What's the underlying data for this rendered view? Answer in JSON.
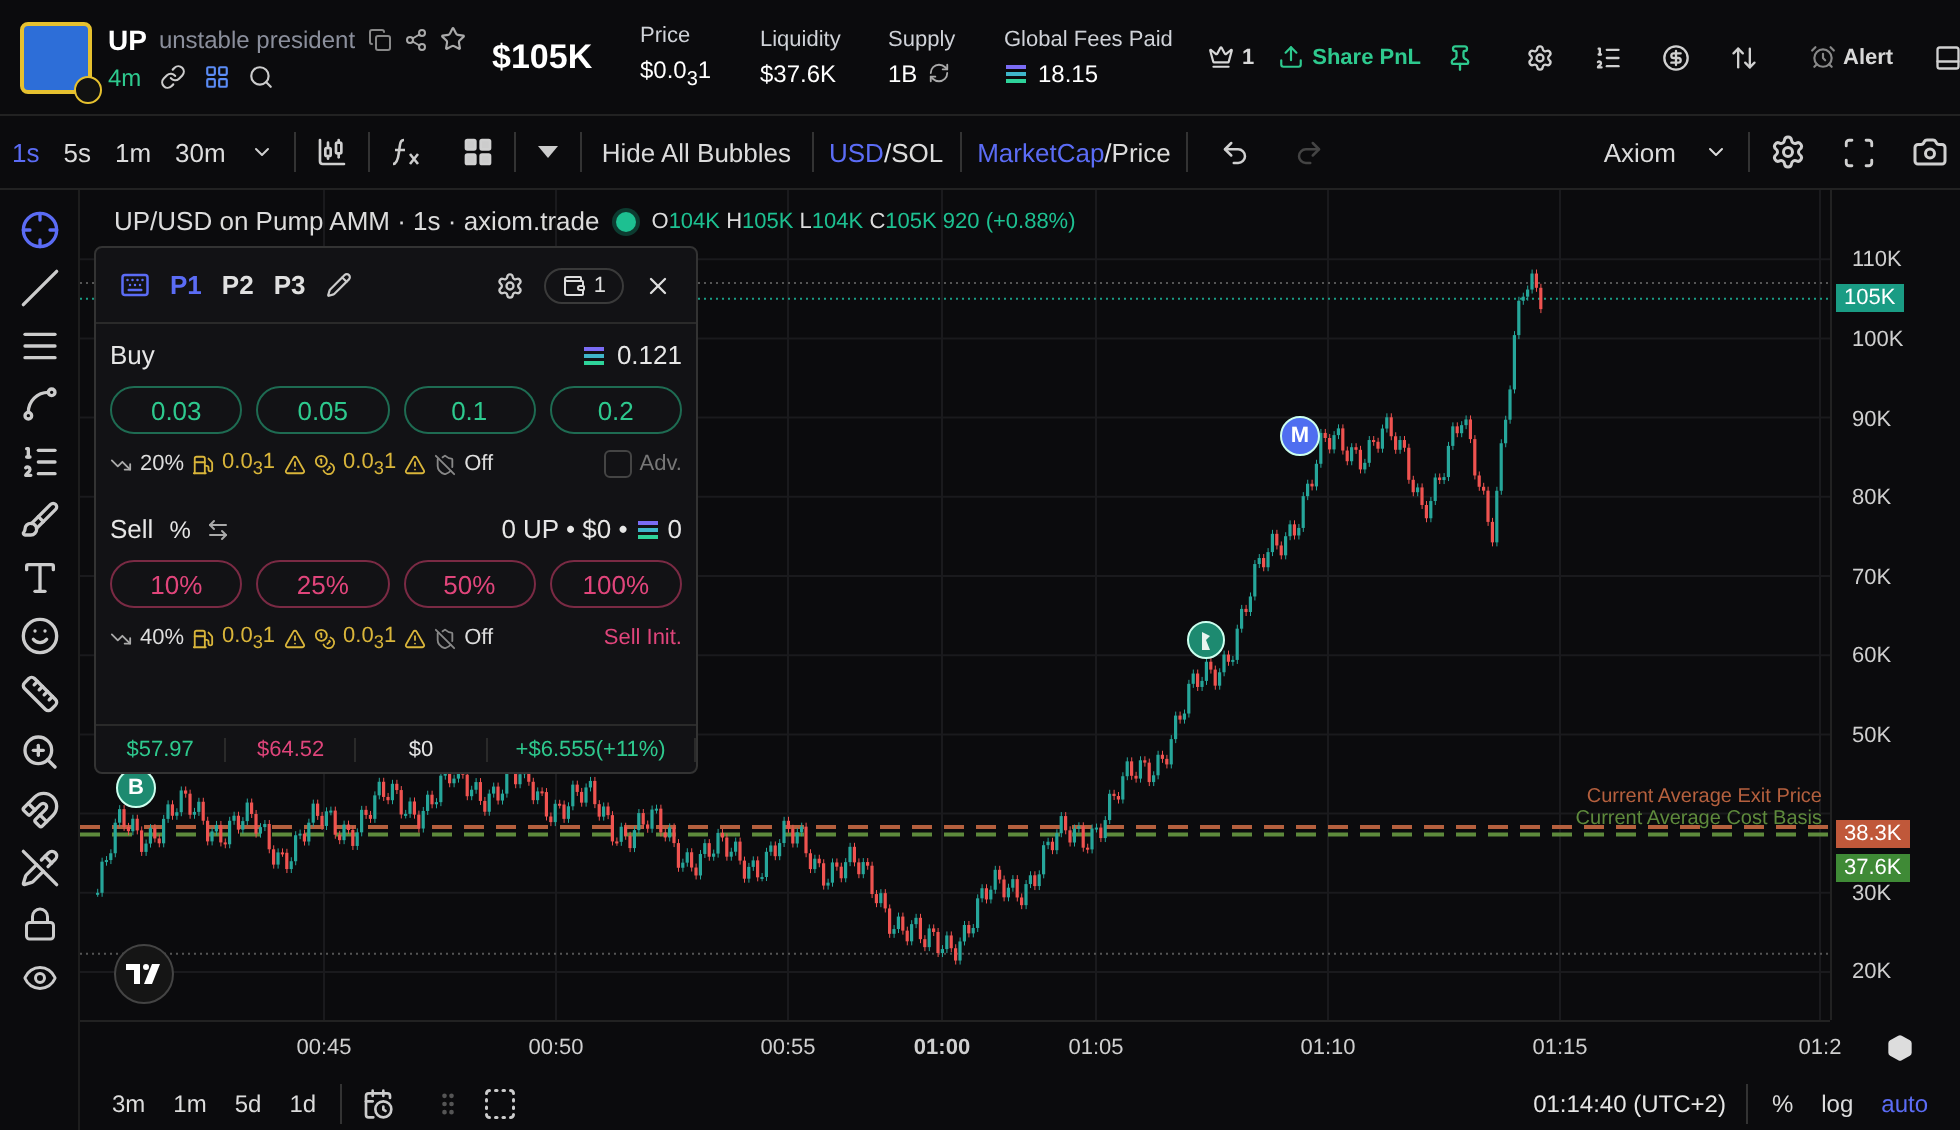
{
  "token": {
    "symbol": "UP",
    "name": "unstable president",
    "age": "4m"
  },
  "market_cap": "$105K",
  "stats": [
    {
      "label": "Price",
      "value": "$0.0$_{3}$1",
      "kind": "plain"
    },
    {
      "label": "Liquidity",
      "value": "$37.6K",
      "kind": "plain"
    },
    {
      "label": "Supply",
      "value": "1B",
      "kind": "refresh"
    },
    {
      "label": "Global Fees Paid",
      "value": "18.15",
      "kind": "sol"
    }
  ],
  "actions": {
    "top_count": "1",
    "share": "Share PnL",
    "alert": "Alert"
  },
  "toolbar": {
    "intervals": [
      {
        "label": "1s",
        "selected": true
      },
      {
        "label": "5s",
        "selected": false
      },
      {
        "label": "1m",
        "selected": false
      },
      {
        "label": "30m",
        "selected": false
      }
    ],
    "bubbles": "Hide All Bubbles",
    "separator": "/",
    "currency": [
      {
        "label": "USD",
        "selected": true
      },
      {
        "label": "SOL",
        "selected": false
      }
    ],
    "metric": [
      {
        "label": "MarketCap",
        "selected": true
      },
      {
        "label": "Price",
        "selected": false
      }
    ],
    "redo_disabled": true,
    "layout": "Axiom"
  },
  "chart": {
    "title": "UP/USD on Pump AMM · 1s · axiom.trade",
    "ohlc": [
      {
        "label": "O",
        "value": "104K"
      },
      {
        "label": "H",
        "value": "105K"
      },
      {
        "label": "L",
        "value": "104K"
      },
      {
        "label": "C",
        "value": "105K"
      }
    ],
    "change": "920 (+0.88%)",
    "price_ticks": [
      "110K",
      "100K",
      "90K",
      "80K",
      "70K",
      "60K",
      "50K",
      "30K",
      "20K"
    ],
    "time_ticks": [
      {
        "label": "00:45",
        "bold": false
      },
      {
        "label": "00:50",
        "bold": false
      },
      {
        "label": "00:55",
        "bold": false
      },
      {
        "label": "01:00",
        "bold": true
      },
      {
        "label": "01:05",
        "bold": false
      },
      {
        "label": "01:10",
        "bold": false
      },
      {
        "label": "01:15",
        "bold": false
      },
      {
        "label": "01:2",
        "bold": false
      }
    ],
    "tags": [
      {
        "label": "105K",
        "color": "#1a9c84"
      },
      {
        "label": "38.3K",
        "color": "#c0583a"
      },
      {
        "label": "37.6K",
        "color": "#3f8a36"
      }
    ],
    "lines": [
      {
        "label": "Current Average Exit Price",
        "color": "#b5603e"
      },
      {
        "label": "Current Average Cost Basis",
        "color": "#5e8a3c"
      }
    ],
    "bubbles": [
      {
        "label": "B",
        "color": "#1d8a70"
      },
      {
        "label": "M",
        "color": "#4f6ef0"
      }
    ]
  },
  "panel": {
    "presets": [
      {
        "label": "P1",
        "selected": true
      },
      {
        "label": "P2",
        "selected": false
      },
      {
        "label": "P3",
        "selected": false
      }
    ],
    "wallets": "1",
    "buy": {
      "label": "Buy",
      "balance": "0.121",
      "amounts": [
        "0.03",
        "0.05",
        "0.1",
        "0.2"
      ],
      "slippage": "20%",
      "priority": "0.0$_{3}$1",
      "bribe": "0.0$_{3}$1",
      "mev": "Off",
      "adv_checked": false,
      "adv": "Adv."
    },
    "sell": {
      "label": "Sell",
      "unit": "%",
      "holdings": "0 UP • $0 •",
      "sol": "0",
      "amounts": [
        "10%",
        "25%",
        "50%",
        "100%"
      ],
      "slippage": "40%",
      "priority": "0.0$_{3}$1",
      "bribe": "0.0$_{3}$1",
      "mev": "Off",
      "init": "Sell Init."
    },
    "footer": [
      {
        "value": "$57.97",
        "color": "#2ec98e"
      },
      {
        "value": "$64.52",
        "color": "#e0457b"
      },
      {
        "value": "$0",
        "color": "#e6e6e6"
      },
      {
        "value": "+$6.555(+11%)",
        "color": "#2ec98e"
      }
    ]
  },
  "ranges": [
    "3m",
    "1m",
    "5d",
    "1d"
  ],
  "clock": "01:14:40 (UTC+2)",
  "scale": [
    {
      "label": "%",
      "selected": false
    },
    {
      "label": "log",
      "selected": false
    },
    {
      "label": "auto",
      "selected": true
    }
  ]
}
